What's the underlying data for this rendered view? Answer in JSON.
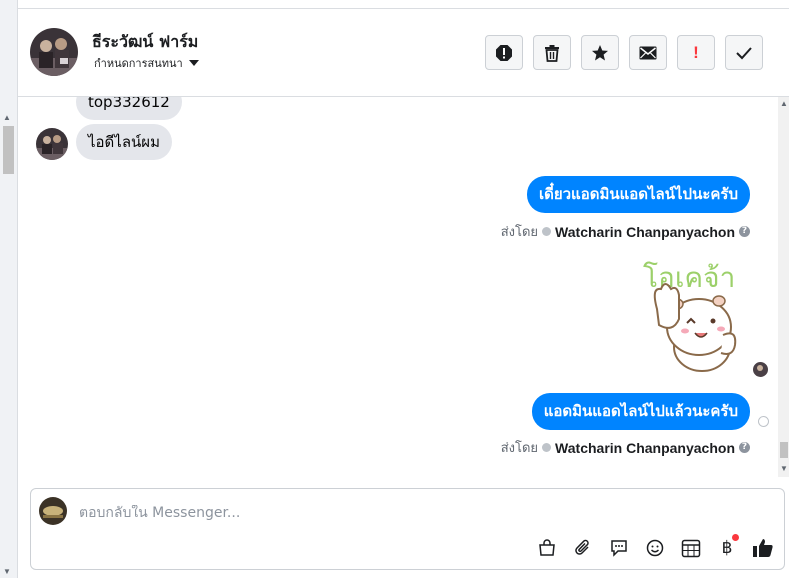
{
  "header": {
    "page_name": "ธีระวัฒน์ ฟาร์ม",
    "assign_label": "กำหนดการสนทนา"
  },
  "toolbar": {
    "actions": [
      "spam-report",
      "delete",
      "star",
      "mark-unread",
      "mark-important",
      "mark-done"
    ],
    "important_glyph": "!"
  },
  "thread": {
    "incoming": [
      {
        "text": "top332612"
      },
      {
        "text": "ไอดีไลน์ผม"
      }
    ],
    "outgoing": [
      {
        "text": "เดี๋ยวแอดมินแอดไลน์ไปนะครับ",
        "sent_by_label": "ส่งโดย",
        "sender": "Watcharin Chanpanyachon"
      },
      {
        "text": "แอดมินแอดไลน์ไปแล้วนะครับ",
        "sent_by_label": "ส่งโดย",
        "sender": "Watcharin Chanpanyachon"
      }
    ],
    "sticker_text": "โอเคจ้า",
    "help_glyph": "?"
  },
  "composer": {
    "placeholder": "ตอบกลับใน Messenger...",
    "tools": [
      "shop-icon",
      "attachment-icon",
      "saved-reply-icon",
      "emoji-icon",
      "appointment-icon",
      "payment-icon",
      "like-icon"
    ],
    "baht_glyph": "฿"
  },
  "colors": {
    "accent": "#0084ff",
    "bubble_in": "#e4e6eb",
    "alert": "#fa383e"
  }
}
